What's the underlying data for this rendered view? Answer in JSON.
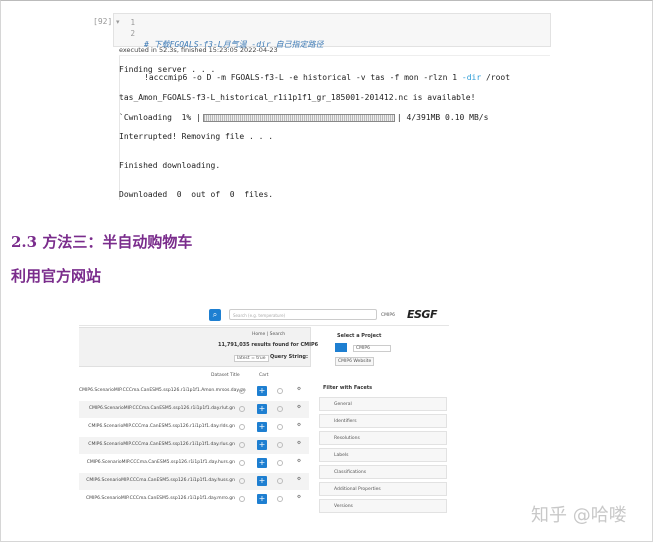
{
  "notebook": {
    "prompt": "[92]:",
    "line_numbers": [
      "1",
      "2"
    ],
    "code_comment": "# 下载FGOALS-f3-L月气温 -dir 自己指定路径",
    "code_cmd": "!acccmip6 -o D -m FGOALS-f3-L -e historical -v tas -f mon -rlzn 1 ",
    "code_dir": "-dir",
    "code_tail": " /root",
    "exec_info": "executed in 52.3s, finished 15:23:05 2022-04-23",
    "output": {
      "line1": "Finding server . . .",
      "line2": "tas_Amon_FGOALS-f3-L_historical_r1i1p1f1_gr_185001-201412.nc is available!",
      "line3_pre": "`Cwnloading  1% |",
      "line3_post": "| 4/391MB 0.10 MB/s",
      "line4": "Interrupted! Removing file . . .",
      "line5": "Finished downloading.",
      "line6": "Downloaded  0  out of  0  files."
    }
  },
  "headings": {
    "method": "2.3 方法三：半自动购物车",
    "official": "利用官方网站"
  },
  "esgf": {
    "logo": "ESGF",
    "search_placeholder": "Search (e.g. temperature)",
    "project_tag": "CMIP6",
    "breadcrumb": "Home | Search",
    "results": "11,791,035 results found for CMIP6",
    "query_label": "Query String:",
    "query_value": "latest = true",
    "col_cart": "Cart",
    "col_dataset": "Dataset Title",
    "select_project": "Select a Project",
    "project_select": "CMIP6",
    "project_button": "CMIP6 Website",
    "filter_label": "Filter with Facets",
    "facets": [
      "General",
      "Identifiers",
      "Resolutions",
      "Labels",
      "Classifications",
      "Additional Properties",
      "Versions"
    ],
    "rows": [
      "CMIP6.ScenarioMIP.CCCma.CanESM5.ssp126.r1i1p1f1.Amon.mrsos.day.gn",
      "CMIP6.ScenarioMIP.CCCma.CanESM5.ssp126.r1i1p1f1.day.rlut.gn",
      "CMIP6.ScenarioMIP.CCCma.CanESM5.ssp126.r1i1p1f1.day.rlds.gn",
      "CMIP6.ScenarioMIP.CCCma.CanESM5.ssp126.r1i1p1f1.day.rlus.gn",
      "CMIP6.ScenarioMIP.CCCma.CanESM5.ssp126.r1i1p1f1.day.hurs.gn",
      "CMIP6.ScenarioMIP.CCCma.CanESM5.ssp126.r1i1p1f1.day.huss.gn",
      "CMIP6.ScenarioMIP.CCCma.CanESM5.ssp126.r1i1p1f1.day.mrro.gn"
    ]
  },
  "watermark": "知乎 @哈喽"
}
